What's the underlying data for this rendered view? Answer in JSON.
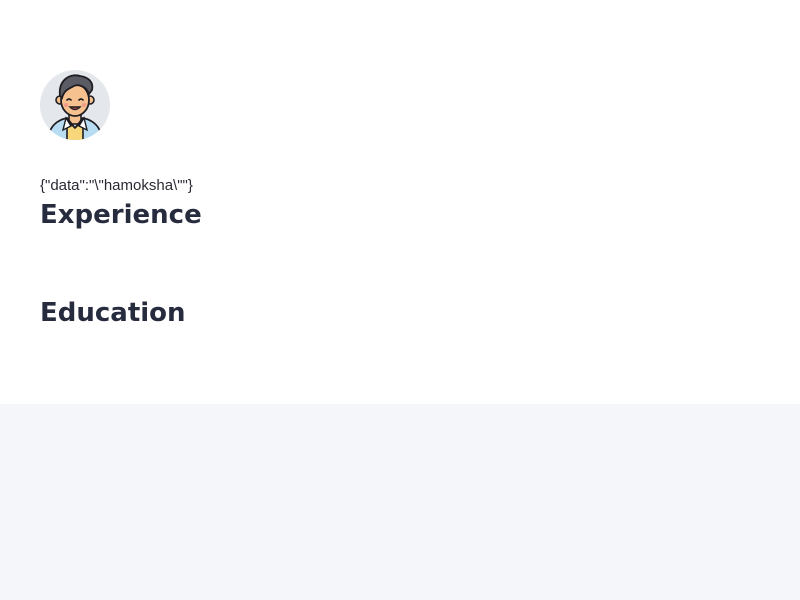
{
  "profile": {
    "avatar_icon": "user-avatar-icon",
    "raw_data_text": "{\"data\":\"\\\"hamoksha\\\"\"}"
  },
  "sections": {
    "experience_title": "Experience",
    "education_title": "Education"
  },
  "colors": {
    "card_background": "#ffffff",
    "page_background": "#f5f6fa",
    "heading_text": "#272b3e",
    "avatar_background": "#e4e7ec"
  }
}
